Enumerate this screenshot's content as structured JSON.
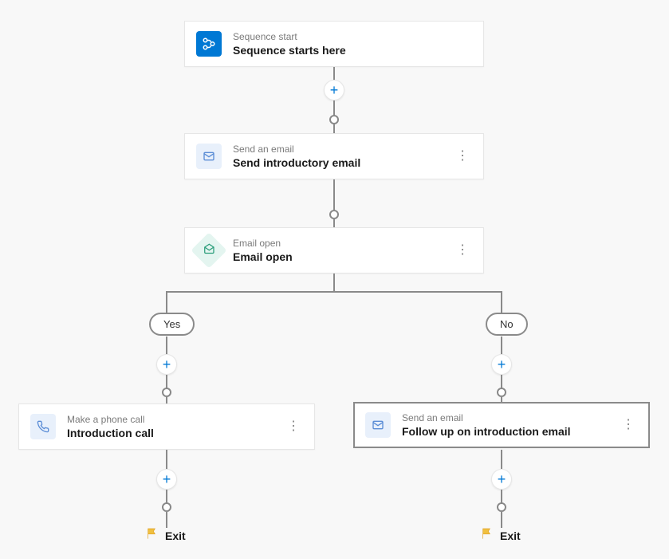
{
  "nodes": {
    "start": {
      "type": "Sequence start",
      "title": "Sequence starts here"
    },
    "email1": {
      "type": "Send an email",
      "title": "Send introductory email"
    },
    "condition": {
      "type": "Email open",
      "title": "Email open"
    },
    "phone": {
      "type": "Make a phone call",
      "title": "Introduction call"
    },
    "email2": {
      "type": "Send an email",
      "title": "Follow up on introduction email"
    }
  },
  "branches": {
    "yes": "Yes",
    "no": "No"
  },
  "exit": "Exit"
}
